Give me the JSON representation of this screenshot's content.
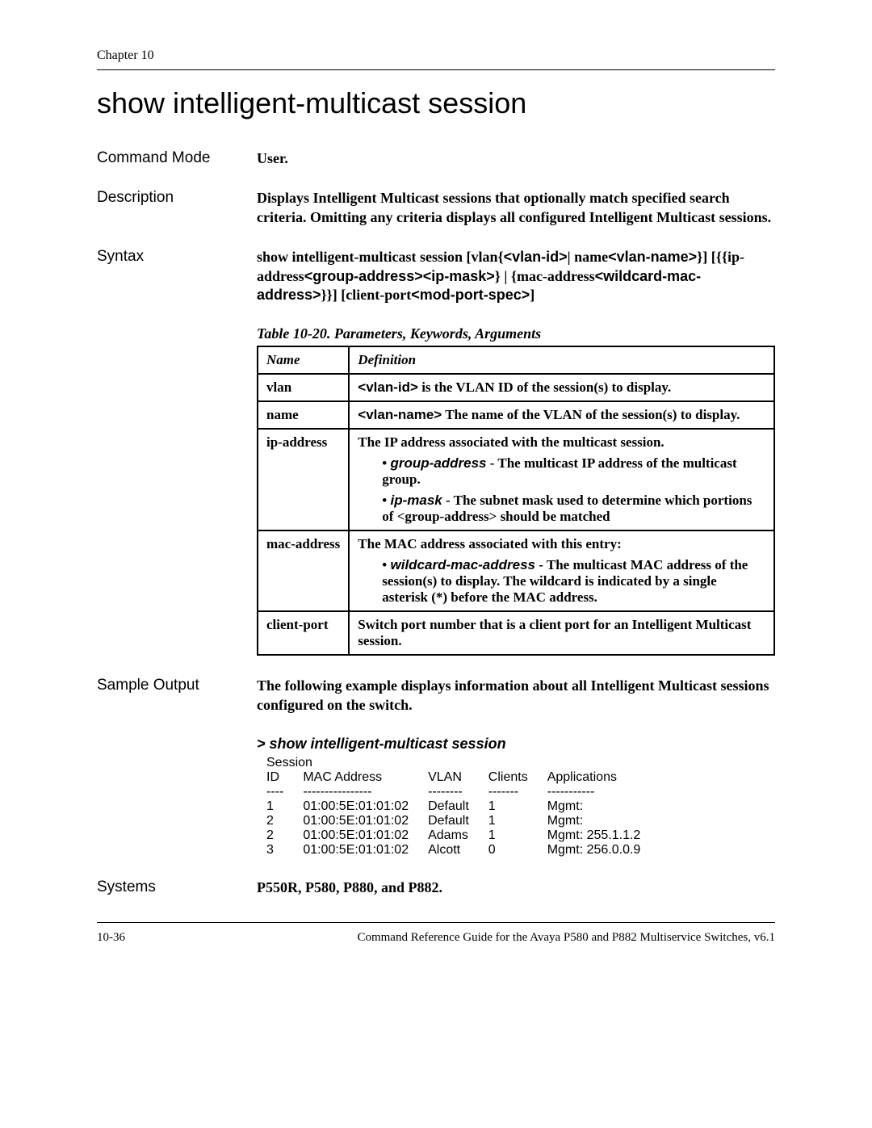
{
  "header": {
    "chapter": "Chapter 10"
  },
  "title": "show intelligent-multicast session",
  "command_mode": {
    "label": "Command Mode",
    "value": "User."
  },
  "description": {
    "label": "Description",
    "value": "Displays Intelligent Multicast sessions that optionally match specified search criteria. Omitting any criteria displays all configured Intelligent Multicast sessions."
  },
  "syntax": {
    "label": "Syntax",
    "prefix": "show intelligent-multicast session [vlan{",
    "vlan_id": "<vlan-id>",
    "mid1": "| name",
    "vlan_name": "<vlan-name>",
    "mid2": "}] [{{ip-address",
    "group_address": "<group-address>",
    "mid3": "",
    "ip_mask": "<ip-mask>",
    "mid4": "} | {mac-address",
    "wildcard_mac": "<wildcard-mac-address>",
    "mid5": "}}] [client-port",
    "mod_port_spec": "<mod-port-spec>",
    "mid6": "]"
  },
  "table": {
    "caption": "Table 10-20.  Parameters, Keywords, Arguments",
    "headers": {
      "name": "Name",
      "definition": "Definition"
    },
    "rows": [
      {
        "name": "vlan",
        "def_prefix_sans": "<vlan-id>",
        "def_rest": " is the VLAN ID of the session(s) to display."
      },
      {
        "name": "name",
        "def_prefix_sans": "<vlan-name>",
        "def_rest": " The name of the VLAN of the session(s) to display."
      },
      {
        "name": "ip-address",
        "def_intro": "The IP address associated with the multicast session.",
        "bullets": [
          {
            "term": "group-address",
            "text": " - The multicast IP address of the multicast group."
          },
          {
            "term": "ip-mask",
            "text": " - The subnet mask used to determine which portions of <group-address> should be matched"
          }
        ]
      },
      {
        "name": "mac-address",
        "def_intro": "The MAC address associated with this entry:",
        "bullets": [
          {
            "term": "wildcard-mac-address",
            "text": " - The multicast MAC address of the session(s) to display. The wildcard is indicated by a single asterisk (*) before the MAC address."
          }
        ]
      },
      {
        "name": "client-port",
        "def_plain": "Switch port number that is a client port for an Intelligent Multicast session."
      }
    ]
  },
  "sample": {
    "label": "Sample Output",
    "intro": "The following example displays information about all Intelligent Multicast sessions configured on the switch.",
    "command": "> show intelligent-multicast session",
    "session_label": "Session",
    "headers": [
      "ID",
      "MAC Address",
      "VLAN",
      "Clients",
      "Applications"
    ],
    "dashes": [
      "----",
      "----------------",
      "--------",
      "-------",
      "-----------"
    ],
    "rows": [
      [
        "1",
        "01:00:5E:01:01:02",
        "Default",
        "1",
        "Mgmt:"
      ],
      [
        "2",
        "01:00:5E:01:01:02",
        "Default",
        "1",
        "Mgmt:"
      ],
      [
        "2",
        "01:00:5E:01:01:02",
        "Adams",
        "1",
        "Mgmt: 255.1.1.2"
      ],
      [
        "3",
        "01:00:5E:01:01:02",
        "Alcott",
        "0",
        "Mgmt: 256.0.0.9"
      ]
    ]
  },
  "systems": {
    "label": "Systems",
    "value": "P550R, P580, P880, and P882."
  },
  "footer": {
    "page": "10-36",
    "guide": "Command Reference Guide for the Avaya P580 and P882 Multiservice Switches, v6.1"
  }
}
